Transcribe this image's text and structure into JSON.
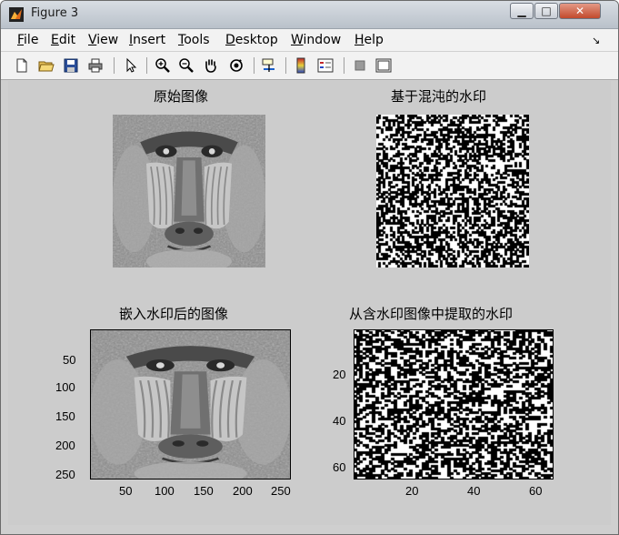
{
  "window": {
    "title": "Figure 3"
  },
  "menu": {
    "items": [
      {
        "label": "File",
        "ul": "F",
        "rest": "ile"
      },
      {
        "label": "Edit",
        "ul": "E",
        "rest": "dit"
      },
      {
        "label": "View",
        "ul": "V",
        "rest": "iew"
      },
      {
        "label": "Insert",
        "ul": "I",
        "rest": "nsert"
      },
      {
        "label": "Tools",
        "ul": "T",
        "rest": "ools"
      },
      {
        "label": "Desktop",
        "ul": "D",
        "rest": "esktop"
      },
      {
        "label": "Window",
        "ul": "W",
        "rest": "indow"
      },
      {
        "label": "Help",
        "ul": "H",
        "rest": "elp"
      }
    ]
  },
  "toolbar": {
    "icons": [
      "new-file-icon",
      "open-folder-icon",
      "save-icon",
      "print-icon",
      "pointer-icon",
      "zoom-in-icon",
      "zoom-out-icon",
      "pan-hand-icon",
      "rotate-3d-icon",
      "data-cursor-icon",
      "colorbar-icon",
      "legend-icon",
      "hide-plot-tools-icon",
      "show-plot-tools-icon"
    ]
  },
  "figure": {
    "panel1": {
      "title": "原始图像"
    },
    "panel2": {
      "title": "基于混沌的水印"
    },
    "panel3": {
      "title": "嵌入水印后的图像",
      "xticks": [
        "50",
        "100",
        "150",
        "200",
        "250"
      ],
      "yticks": [
        "50",
        "100",
        "150",
        "200",
        "250"
      ]
    },
    "panel4": {
      "title": "从含水印图像中提取的水印",
      "xticks": [
        "20",
        "40",
        "60"
      ],
      "yticks": [
        "20",
        "40",
        "60"
      ]
    }
  },
  "colors": {
    "figure_bg": "#cccccc",
    "window_bg": "#cfcfcf",
    "menubar_bg": "#f2f2f2"
  }
}
